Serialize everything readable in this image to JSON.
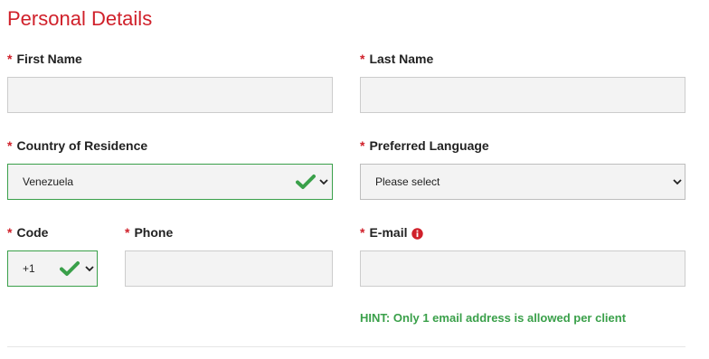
{
  "section": {
    "title": "Personal Details",
    "required_marker": "*"
  },
  "fields": {
    "first_name": {
      "label": "First Name",
      "value": ""
    },
    "last_name": {
      "label": "Last Name",
      "value": ""
    },
    "country": {
      "label": "Country of Residence",
      "value": "Venezuela"
    },
    "language": {
      "label": "Preferred Language",
      "value": "Please select"
    },
    "code": {
      "label": "Code",
      "value": "+1"
    },
    "phone": {
      "label": "Phone",
      "value": ""
    },
    "email": {
      "label": "E-mail",
      "value": ""
    }
  },
  "hint": "HINT: Only 1 email address is allowed per client",
  "colors": {
    "accent_red": "#d0202a",
    "valid_green": "#3aa04a",
    "input_bg": "#f3f3f3",
    "border": "#cccccc"
  },
  "icons": {
    "valid": "check-icon",
    "dropdown": "chevron-down-icon",
    "info": "info-circle-icon"
  }
}
